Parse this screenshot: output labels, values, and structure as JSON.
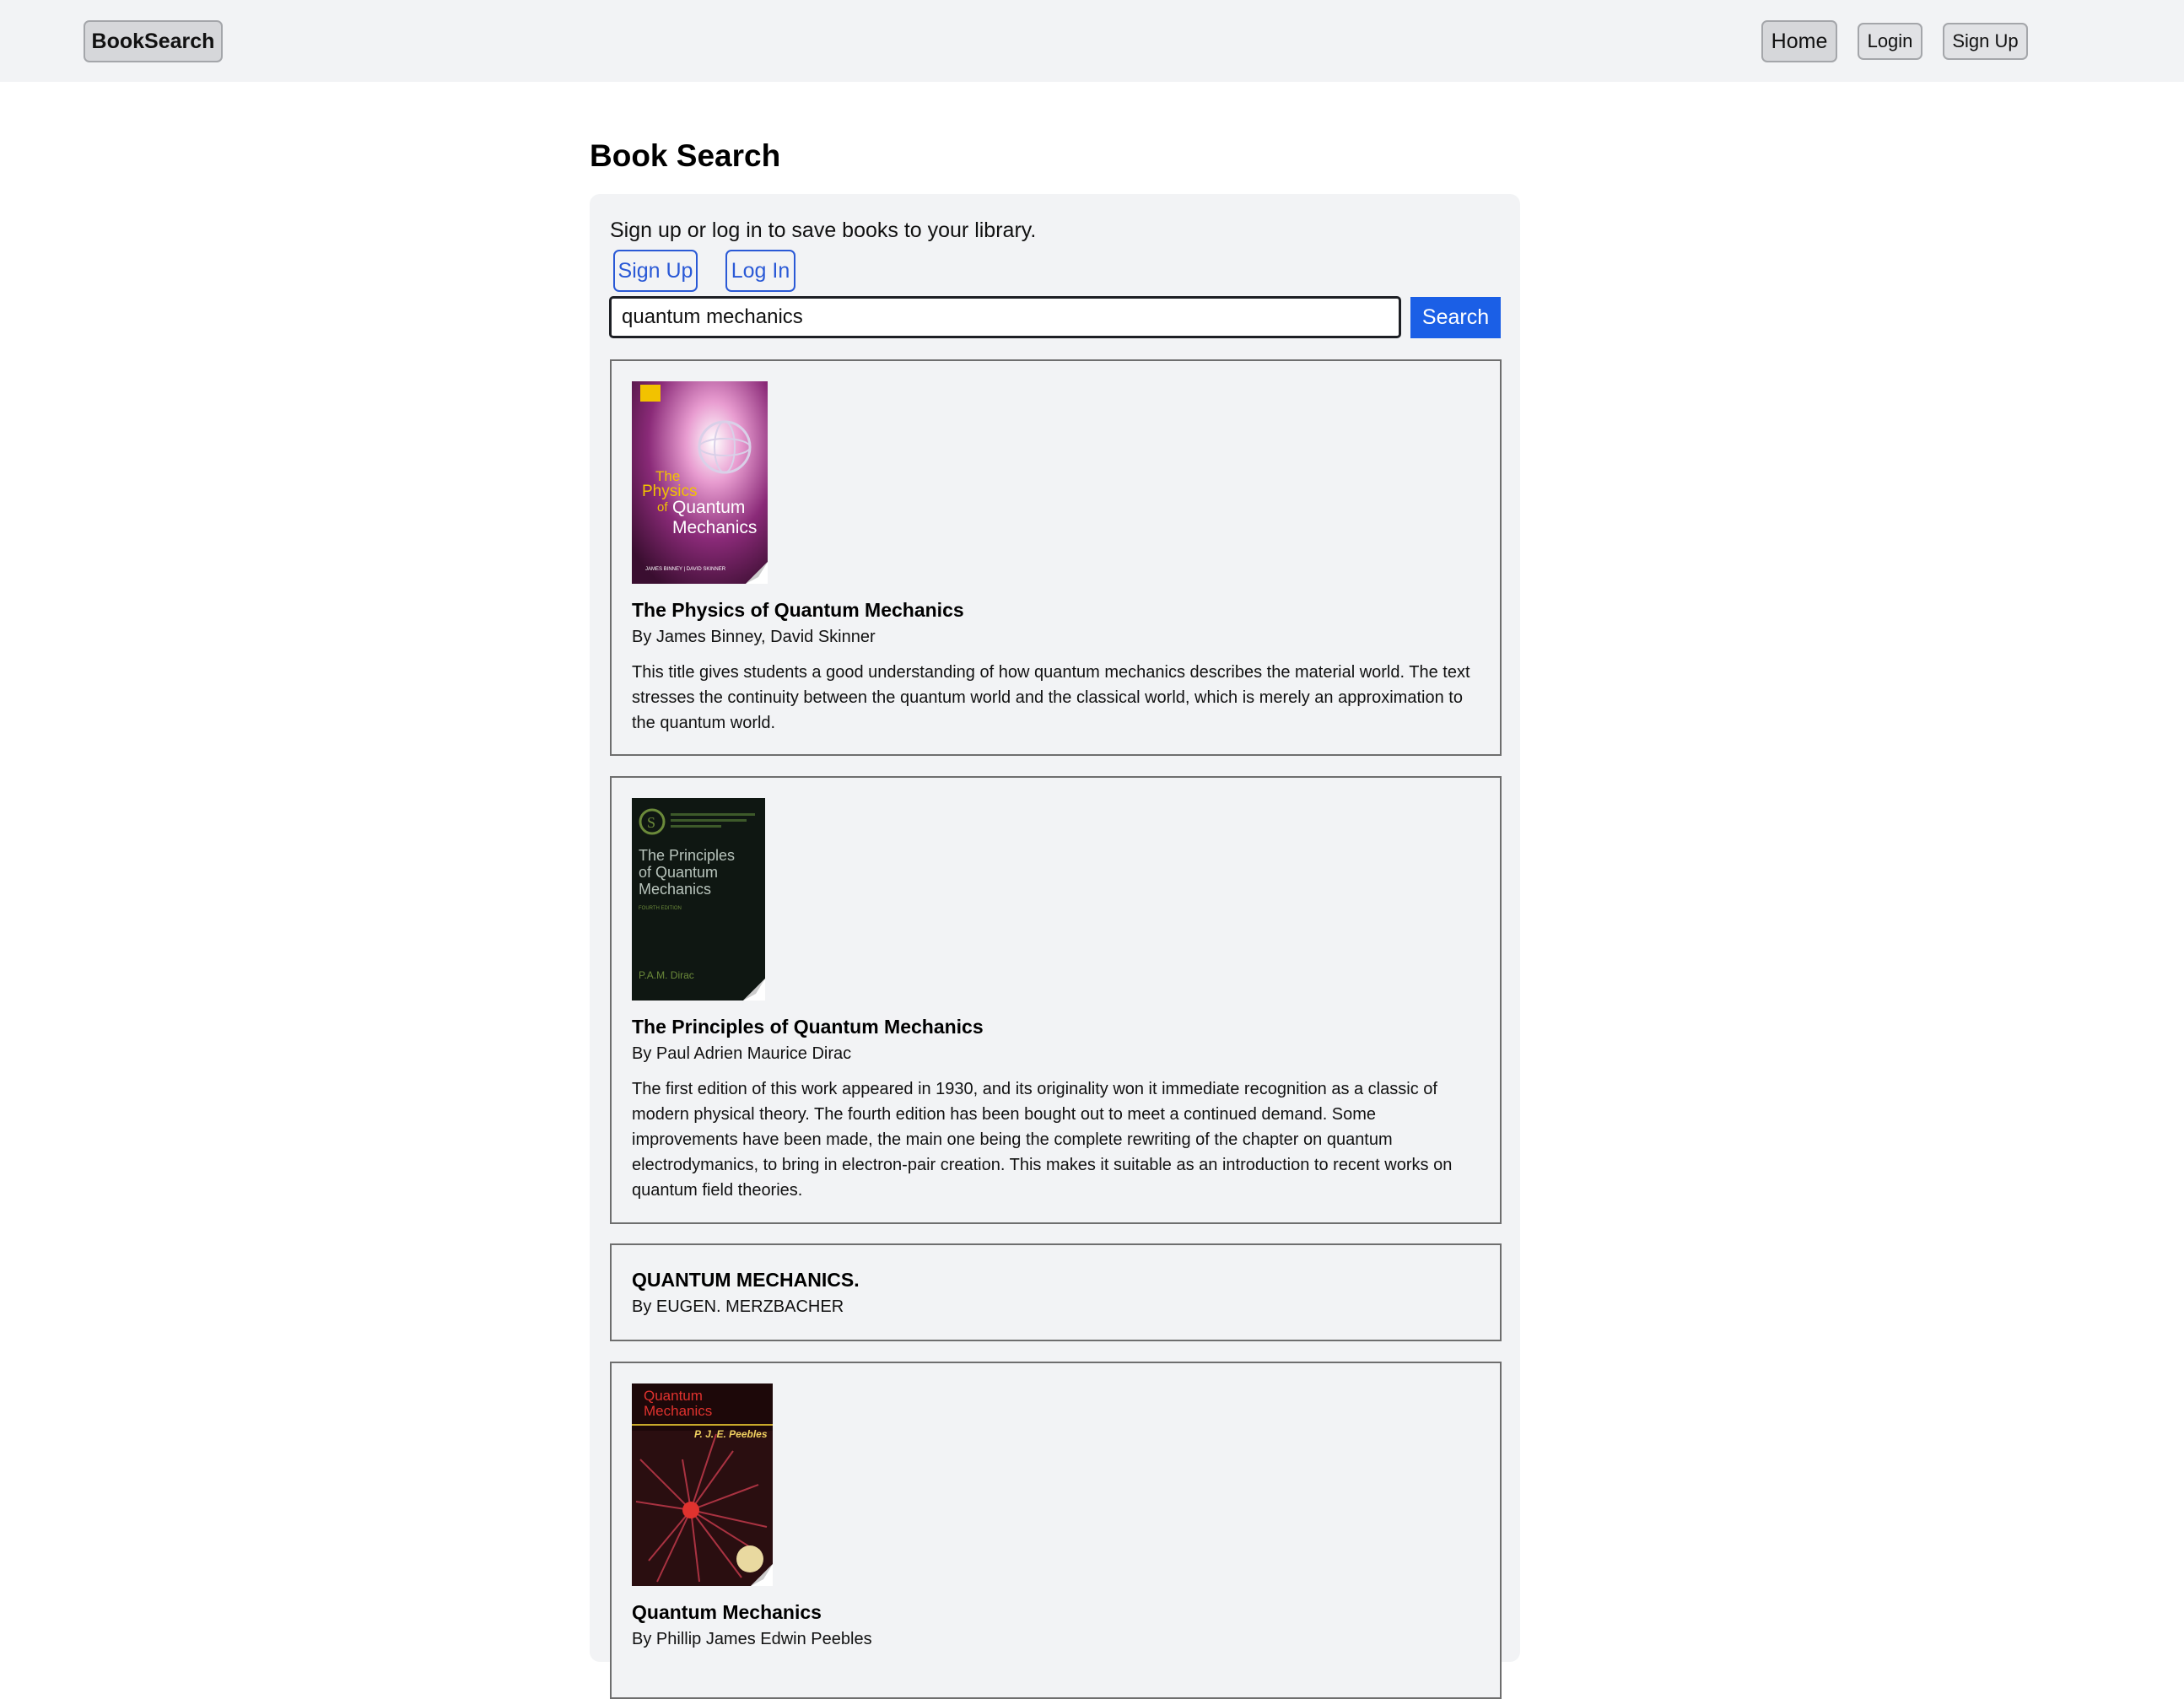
{
  "header": {
    "brand": "BookSearch",
    "nav": {
      "home": "Home",
      "login": "Login",
      "signup": "Sign Up"
    }
  },
  "page": {
    "title": "Book Search",
    "prompt": "Sign up or log in to save books to your library.",
    "signup_link": "Sign Up",
    "login_link": "Log In"
  },
  "search": {
    "value": "quantum mechanics",
    "button": "Search"
  },
  "results": [
    {
      "title": "The Physics of Quantum Mechanics",
      "author": "By James Binney, David Skinner",
      "description": "This title gives students a good understanding of how quantum mechanics describes the material world. The text stresses the continuity between the quantum world and the classical world, which is merely an approximation to the quantum world.",
      "cover": {
        "colors": {
          "bg": "#5a1a4a",
          "accent": "#e89cd0",
          "badge": "#f2c200"
        },
        "text": "The Physics of Quantum Mechanics",
        "line_the": "The",
        "line_physics": "Physics",
        "line_of": "of",
        "line_quantum": "Quantum",
        "line_mechanics": "Mechanics",
        "authors": "JAMES BINNEY | DAVID SKINNER"
      }
    },
    {
      "title": "The Principles of Quantum Mechanics",
      "author": "By Paul Adrien Maurice Dirac",
      "description": "The first edition of this work appeared in 1930, and its originality won it immediate recognition as a classic of modern physical theory. The fourth edition has been bought out to meet a continued demand. Some improvements have been made, the main one being the complete rewriting of the chapter on quantum electrodymanics, to bring in electron-pair creation. This makes it suitable as an introduction to recent works on quantum field theories.",
      "cover": {
        "colors": {
          "bg": "#0f1712",
          "text": "#b8c4bc",
          "accent": "#6b8a3a"
        },
        "line1": "The Principles",
        "line2": "of Quantum",
        "line3": "Mechanics",
        "edition": "FOURTH EDITION",
        "author": "P.A.M. Dirac"
      }
    },
    {
      "title": "QUANTUM MECHANICS.",
      "author": "By EUGEN. MERZBACHER"
    },
    {
      "title": "Quantum Mechanics",
      "author": "By Phillip James Edwin Peebles",
      "cover": {
        "colors": {
          "bg": "#2a0e10",
          "title": "#e0322e",
          "author": "#f0d060"
        },
        "line1": "Quantum",
        "line2": "Mechanics",
        "author": "P. J. E. Peebles"
      }
    }
  ]
}
